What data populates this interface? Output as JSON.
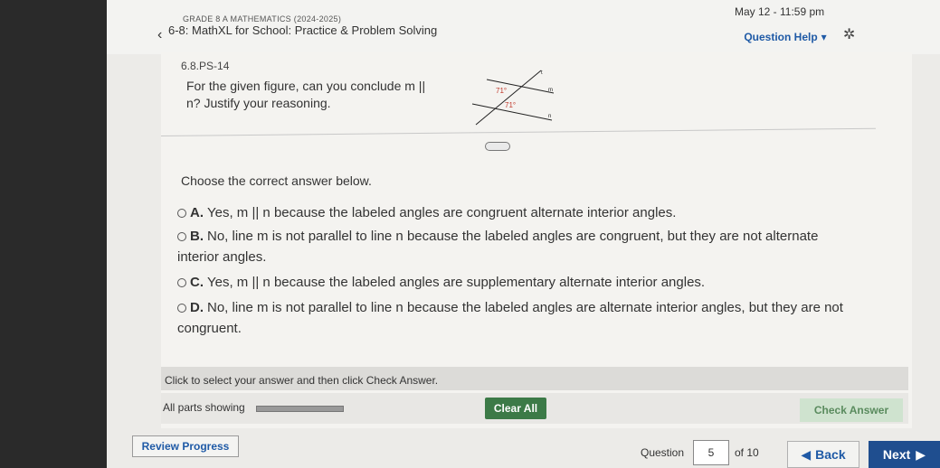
{
  "header": {
    "course": "GRADE 8 A MATHEMATICS (2024-2025)",
    "chapter": "6-8: MathXL for School: Practice & Problem Solving",
    "datetime": "May 12 - 11:59 pm",
    "help_label": "Question Help",
    "help_caret": "▾",
    "back_chevron": "‹",
    "gear_icon": "gear-icon"
  },
  "question": {
    "id": "6.8.PS-14",
    "text": "For the given figure, can you conclude m || n? Justify your reasoning.",
    "figure": {
      "angle1": "71°",
      "angle2": "71°",
      "label_t": "t",
      "label_m": "m",
      "label_n": "n"
    },
    "more_icon": "•••"
  },
  "answers": {
    "prompt": "Choose the correct answer below.",
    "options": [
      {
        "letter": "A.",
        "text": "Yes, m || n because the labeled angles are congruent alternate interior angles."
      },
      {
        "letter": "B.",
        "text": "No, line m is not parallel to line n because the labeled angles are congruent, but they are not alternate interior angles."
      },
      {
        "letter": "C.",
        "text": "Yes, m || n because the labeled angles are supplementary alternate interior angles."
      },
      {
        "letter": "D.",
        "text": "No, line m is not parallel to line n because the labeled angles are alternate interior angles, but they are not congruent."
      }
    ]
  },
  "footer": {
    "instructions": "Click to select your answer and then click Check Answer.",
    "parts_label": "All parts showing",
    "clear_all": "Clear All",
    "check_answer": "Check Answer",
    "review_progress": "Review Progress",
    "question_label": "Question",
    "question_number": "5",
    "of_label": "of 10",
    "back_label": "Back",
    "next_label": "Next"
  },
  "colors": {
    "accent": "#1f5aa6",
    "clear_btn": "#3c7a47",
    "next_btn": "#1f4e8f",
    "check_btn_bg": "#cfe3cf"
  }
}
